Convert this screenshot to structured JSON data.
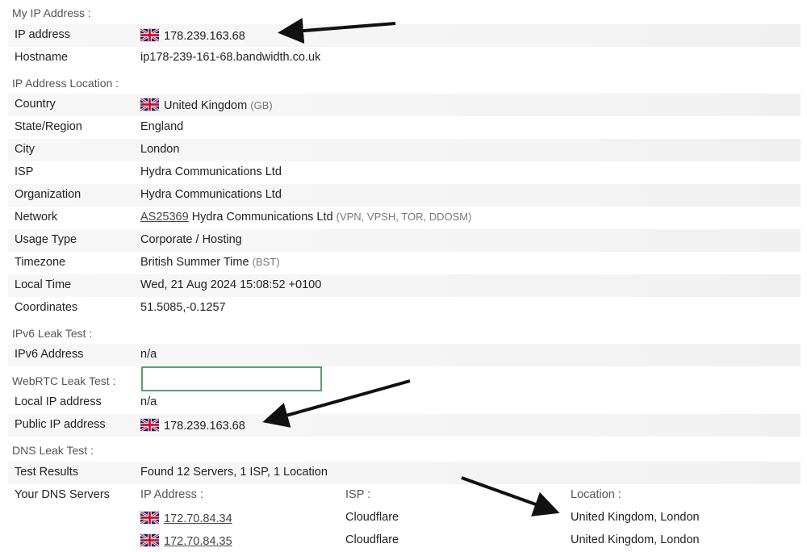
{
  "sections": {
    "my_ip": "My IP Address :",
    "location": "IP Address Location :",
    "ipv6": "IPv6 Leak Test :",
    "webrtc": "WebRTC Leak Test :",
    "dns": "DNS Leak Test :"
  },
  "my_ip": {
    "ip_label": "IP address",
    "ip_value": "178.239.163.68",
    "hostname_label": "Hostname",
    "hostname_value": "ip178-239-161-68.bandwidth.co.uk"
  },
  "location": {
    "country_label": "Country",
    "country_value": "United Kingdom",
    "country_code": "(GB)",
    "state_label": "State/Region",
    "state_value": "England",
    "city_label": "City",
    "city_value": "London",
    "isp_label": "ISP",
    "isp_value": "Hydra Communications Ltd",
    "org_label": "Organization",
    "org_value": "Hydra Communications Ltd",
    "network_label": "Network",
    "network_as": "AS25369",
    "network_name": "Hydra Communications Ltd",
    "network_tags": "(VPN, VPSH, TOR, DDOSM)",
    "usage_label": "Usage Type",
    "usage_value": "Corporate / Hosting",
    "timezone_label": "Timezone",
    "timezone_value": "British Summer Time",
    "timezone_abbr": "(BST)",
    "localtime_label": "Local Time",
    "localtime_value": "Wed, 21 Aug 2024 15:08:52 +0100",
    "coords_label": "Coordinates",
    "coords_value": "51.5085,-0.1257"
  },
  "ipv6": {
    "address_label": "IPv6 Address",
    "address_value": "n/a"
  },
  "webrtc": {
    "local_label": "Local IP address",
    "local_value": "n/a",
    "public_label": "Public IP address",
    "public_value": "178.239.163.68"
  },
  "dns": {
    "results_label": "Test Results",
    "results_value": "Found 12 Servers, 1 ISP, 1 Location",
    "servers_label": "Your DNS Servers",
    "col_ip": "IP Address :",
    "col_isp": "ISP :",
    "col_location": "Location :",
    "servers": [
      {
        "ip": "172.70.84.34",
        "isp": "Cloudflare",
        "location": "United Kingdom, London"
      },
      {
        "ip": "172.70.84.35",
        "isp": "Cloudflare",
        "location": "United Kingdom, London"
      }
    ]
  },
  "icons": {
    "flag": "uk-flag-icon",
    "arrow": "annotation-arrow"
  }
}
